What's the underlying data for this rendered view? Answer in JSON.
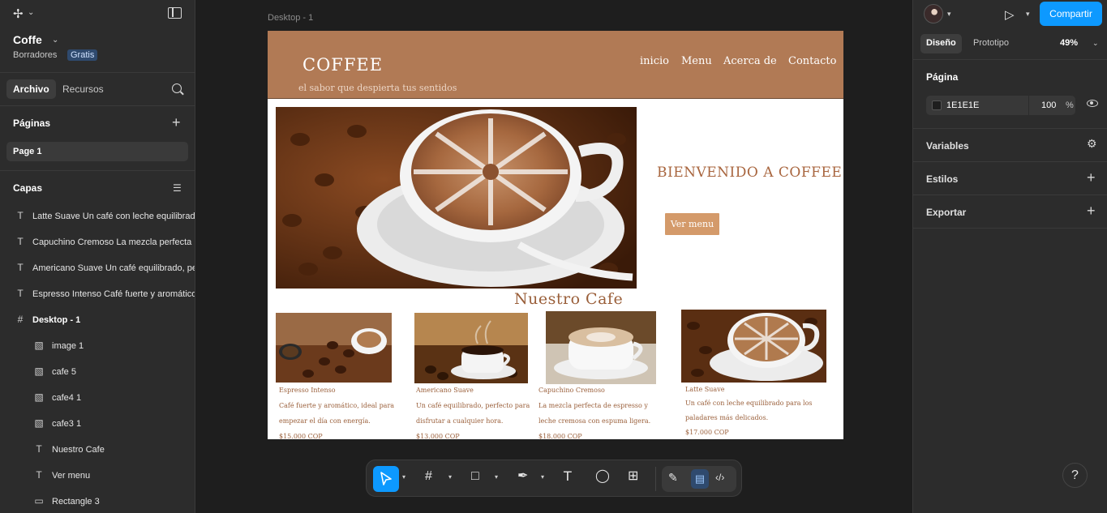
{
  "left_panel": {
    "file_name": "Coffe",
    "drafts_label": "Borradores",
    "plan_badge": "Gratis",
    "tabs": {
      "active": "Archivo",
      "other": "Recursos"
    },
    "pages_title": "Páginas",
    "pages": [
      "Page 1"
    ],
    "layers_title": "Capas",
    "layers": [
      {
        "icon": "T",
        "name": "Latte Suave Un café con leche equilibrado"
      },
      {
        "icon": "T",
        "name": "Capuchino Cremoso La mezcla perfecta"
      },
      {
        "icon": "T",
        "name": "Americano Suave Un café equilibrado, perfecto"
      },
      {
        "icon": "T",
        "name": "Espresso Intenso Café fuerte y aromático"
      },
      {
        "icon": "#",
        "name": "Desktop - 1"
      },
      {
        "icon": "img",
        "name": "image 1"
      },
      {
        "icon": "img",
        "name": "cafe 5"
      },
      {
        "icon": "img",
        "name": "cafe4 1"
      },
      {
        "icon": "img",
        "name": "cafe3 1"
      },
      {
        "icon": "T",
        "name": "Nuestro Cafe"
      },
      {
        "icon": "T",
        "name": "Ver menu"
      },
      {
        "icon": "rect",
        "name": "Rectangle 3"
      }
    ]
  },
  "canvas": {
    "frame_label": "Desktop - 1",
    "site": {
      "brand": "COFFEE",
      "tagline": "el sabor que despierta tus sentidos",
      "nav": [
        "inicio",
        "Menu",
        "Acerca de",
        "Contacto"
      ],
      "welcome": "BIENVENIDO A COFFEE",
      "cta": "Ver menu",
      "section_title": "Nuestro Cafe",
      "cards": [
        {
          "title": "Espresso Intenso",
          "desc": "Café fuerte y aromático, ideal para empezar el día con energía.",
          "price": "$15.000 COP"
        },
        {
          "title": "Americano Suave",
          "desc": "Un café equilibrado, perfecto para disfrutar a cualquier hora.",
          "price": "$13.000 COP"
        },
        {
          "title": "Capuchino Cremoso",
          "desc": "La mezcla perfecta de espresso y leche cremosa con espuma ligera.",
          "price": "$18.000 COP"
        },
        {
          "title": "Latte Suave",
          "desc": "Un café con leche equilibrado para los paladares más delicados.",
          "price": "$17.000 COP"
        }
      ]
    }
  },
  "right_panel": {
    "share_label": "Compartir",
    "tabs": {
      "active": "Diseño",
      "other": "Prototipo"
    },
    "zoom": "49%",
    "page_title": "Página",
    "background_hex": "1E1E1E",
    "opacity": "100",
    "opacity_unit": "%",
    "sections": [
      "Variables",
      "Estilos",
      "Exportar"
    ]
  },
  "help_label": "?",
  "colors": {
    "accent": "#0d99ff",
    "header_brown": "#b17a55",
    "cta": "#d49a6a",
    "text_brown": "#9a5f3a"
  }
}
